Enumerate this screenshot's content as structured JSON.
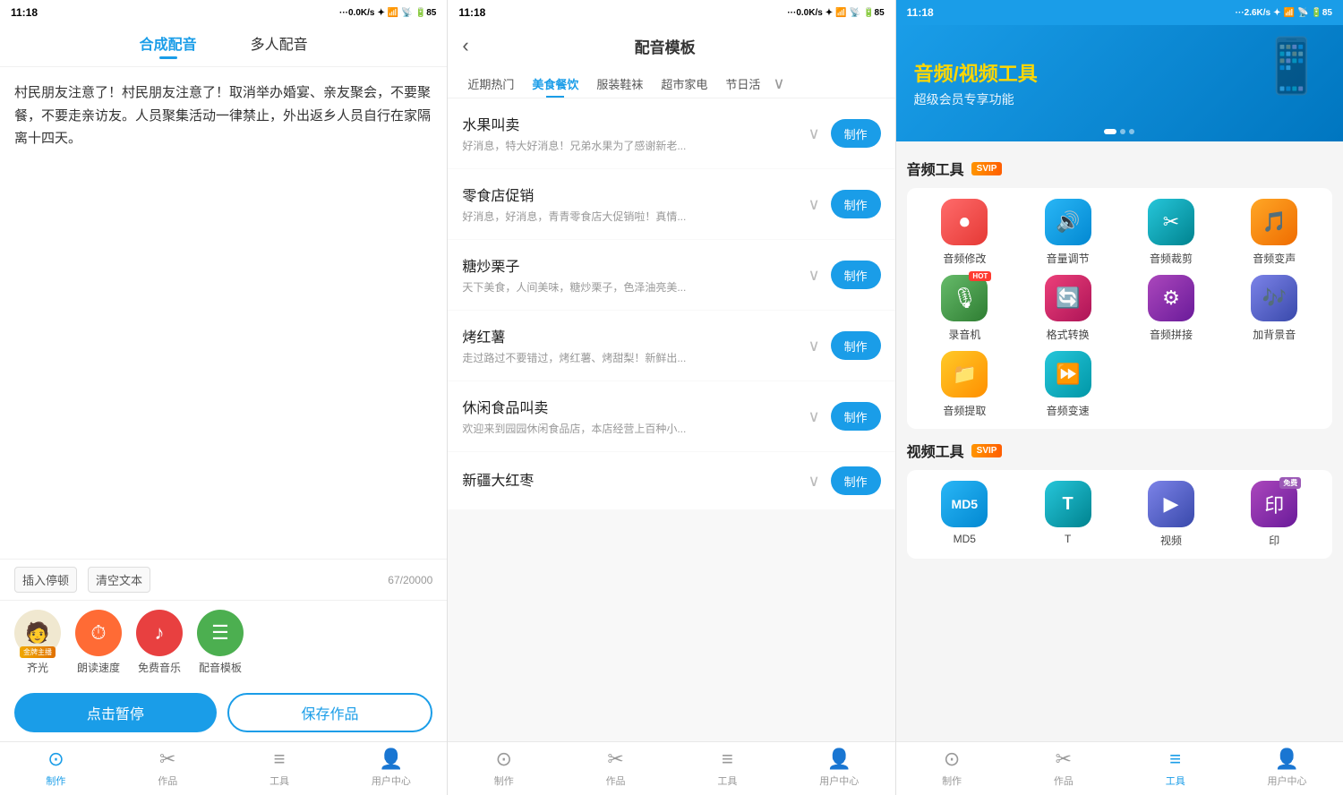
{
  "panel1": {
    "status": {
      "time": "11:18",
      "network": "...0.0K/s",
      "battery": "85"
    },
    "tabs": [
      {
        "label": "合成配音",
        "active": true
      },
      {
        "label": "多人配音",
        "active": false
      }
    ],
    "textarea": {
      "content": "村民朋友注意了！村民朋友注意了！取消举办婚宴、亲友聚会，不要聚餐，不要走亲访友。人员聚集活动一律禁止，外出返乡人员自行在家隔离十四天。"
    },
    "toolbar": {
      "insert_label": "插入停顿",
      "clear_label": "清空文本",
      "count": "67/20000"
    },
    "voice_items": [
      {
        "name": "齐光",
        "badge": "金牌主播",
        "emoji": "🧑"
      },
      {
        "name": "朗读速度",
        "icon": "⏱",
        "color": "orange"
      },
      {
        "name": "免费音乐",
        "icon": "♪",
        "color": "red"
      },
      {
        "name": "配音模板",
        "icon": "☰",
        "color": "green"
      }
    ],
    "actions": {
      "pause_label": "点击暂停",
      "save_label": "保存作品"
    },
    "nav": [
      {
        "label": "制作",
        "active": true
      },
      {
        "label": "作品",
        "active": false
      },
      {
        "label": "工具",
        "active": false
      },
      {
        "label": "用户中心",
        "active": false
      }
    ]
  },
  "panel2": {
    "status": {
      "time": "11:18",
      "network": "...0.0K/s",
      "battery": "85"
    },
    "title": "配音模板",
    "categories": [
      {
        "label": "近期热门",
        "active": false
      },
      {
        "label": "美食餐饮",
        "active": true
      },
      {
        "label": "服装鞋袜",
        "active": false
      },
      {
        "label": "超市家电",
        "active": false
      },
      {
        "label": "节日活",
        "active": false
      },
      {
        "label": "更多",
        "active": false
      }
    ],
    "templates": [
      {
        "name": "水果叫卖",
        "desc": "好消息，特大好消息！兄弟水果为了感谢新老...",
        "make": "制作"
      },
      {
        "name": "零食店促销",
        "desc": "好消息，好消息，青青零食店大促销啦！真情...",
        "make": "制作"
      },
      {
        "name": "糖炒栗子",
        "desc": "天下美食，人间美味，糖炒栗子，色泽油亮美...",
        "make": "制作"
      },
      {
        "name": "烤红薯",
        "desc": "走过路过不要错过，烤红薯、烤甜梨！新鲜出...",
        "make": "制作"
      },
      {
        "name": "休闲食品叫卖",
        "desc": "欢迎来到园园休闲食品店，本店经营上百种小...",
        "make": "制作"
      },
      {
        "name": "新疆大红枣",
        "desc": "",
        "make": "制作"
      }
    ],
    "nav": [
      {
        "label": "制作",
        "active": false
      },
      {
        "label": "作品",
        "active": false
      },
      {
        "label": "工具",
        "active": false
      },
      {
        "label": "用户中心",
        "active": false
      }
    ]
  },
  "panel3": {
    "status": {
      "time": "11:18",
      "network": "...2.6K/s",
      "battery": "85"
    },
    "banner": {
      "title": "音频/视频工具",
      "subtitle": "超级会员专享功能"
    },
    "audio_section": {
      "title": "音频工具",
      "badge": "SVIP",
      "tools": [
        {
          "name": "音频修改",
          "color": "red",
          "icon": "⏺",
          "hot": false
        },
        {
          "name": "音量调节",
          "color": "blue",
          "icon": "🔊",
          "hot": false
        },
        {
          "name": "音频裁剪",
          "color": "teal",
          "icon": "✂",
          "hot": false
        },
        {
          "name": "音频变声",
          "color": "orange",
          "icon": "🎵",
          "hot": false
        },
        {
          "name": "录音机",
          "color": "green",
          "icon": "🎙",
          "hot": true
        },
        {
          "name": "格式转换",
          "color": "pink",
          "icon": "🔄",
          "hot": false
        },
        {
          "name": "音频拼接",
          "color": "purple",
          "icon": "⚙",
          "hot": false
        },
        {
          "name": "加背景音",
          "color": "indigo",
          "icon": "🎶",
          "hot": false
        },
        {
          "name": "音频提取",
          "color": "amber",
          "icon": "📁",
          "hot": false
        },
        {
          "name": "音频变速",
          "color": "cyan",
          "icon": "⏩",
          "hot": false
        }
      ]
    },
    "video_section": {
      "title": "视频工具",
      "badge": "SVIP",
      "tools": [
        {
          "name": "MD5",
          "color": "blue",
          "icon": "M",
          "hot": false,
          "free": false
        },
        {
          "name": "T",
          "color": "teal",
          "icon": "T",
          "hot": false,
          "free": false
        },
        {
          "name": "视频",
          "color": "indigo",
          "icon": "▶",
          "hot": false,
          "free": false
        },
        {
          "name": "印",
          "color": "purple",
          "icon": "印",
          "hot": false,
          "free": true
        }
      ]
    },
    "nav": [
      {
        "label": "制作",
        "active": false
      },
      {
        "label": "作品",
        "active": false
      },
      {
        "label": "工具",
        "active": true
      },
      {
        "label": "用户中心",
        "active": false
      }
    ]
  }
}
